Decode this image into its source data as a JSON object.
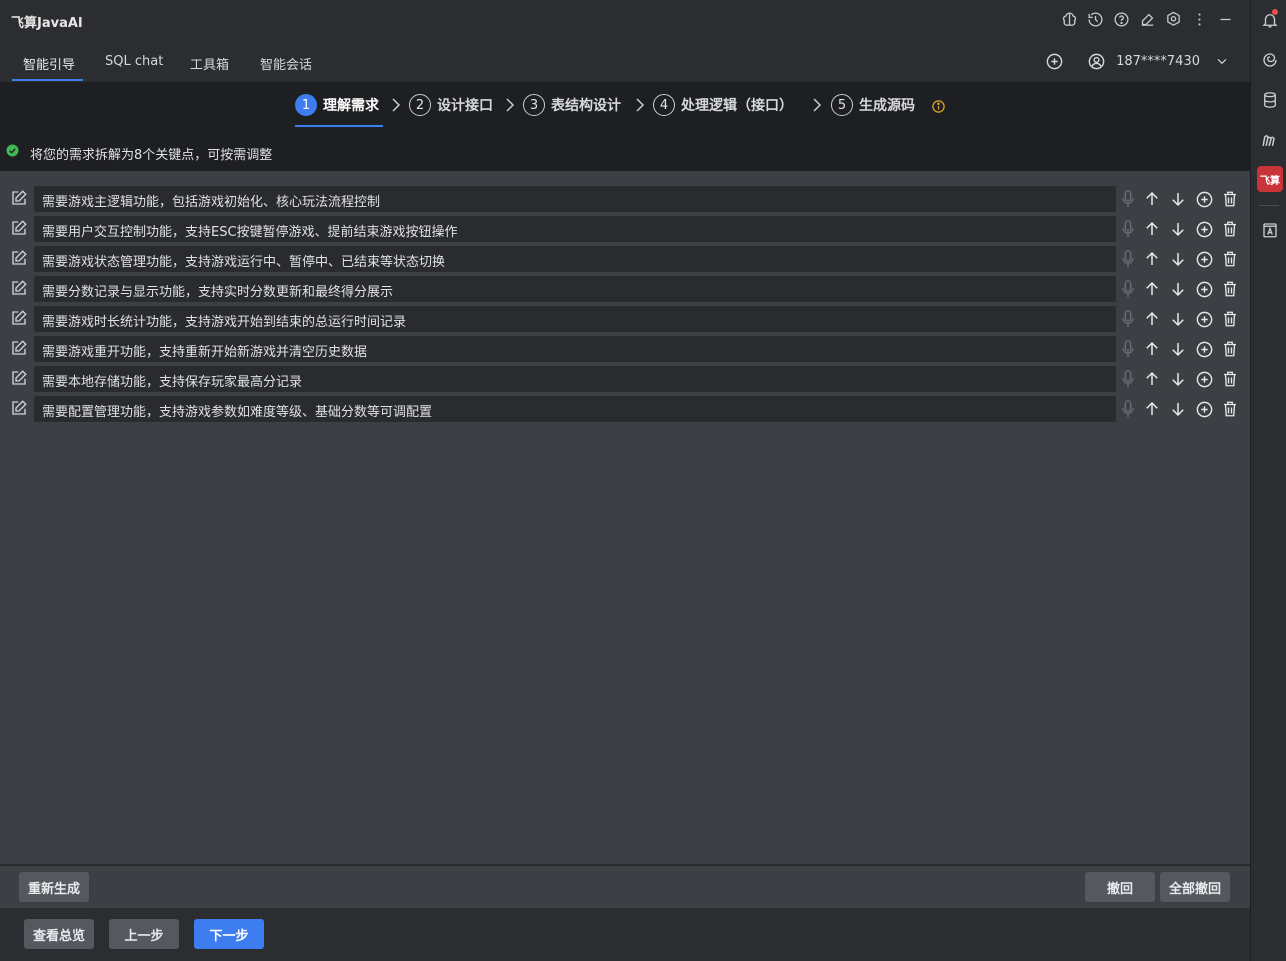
{
  "app": {
    "title": "飞算JavaAI"
  },
  "tabs": [
    {
      "label": "智能引导"
    },
    {
      "label": "SQL chat"
    },
    {
      "label": "工具箱"
    },
    {
      "label": "智能会话"
    }
  ],
  "user": {
    "name": "187****7430"
  },
  "steps": [
    {
      "num": "1",
      "label": "理解需求"
    },
    {
      "num": "2",
      "label": "设计接口"
    },
    {
      "num": "3",
      "label": "表结构设计"
    },
    {
      "num": "4",
      "label": "处理逻辑（接口）"
    },
    {
      "num": "5",
      "label": "生成源码"
    }
  ],
  "status": {
    "text": "将您的需求拆解为8个关键点，可按需调整"
  },
  "requirements": [
    "需要游戏主逻辑功能，包括游戏初始化、核心玩法流程控制",
    "需要用户交互控制功能，支持ESC按键暂停游戏、提前结束游戏按钮操作",
    "需要游戏状态管理功能，支持游戏运行中、暂停中、已结束等状态切换",
    "需要分数记录与显示功能，支持实时分数更新和最终得分展示",
    "需要游戏时长统计功能，支持游戏开始到结束的总运行时间记录",
    "需要游戏重开功能，支持重新开始新游戏并清空历史数据",
    "需要本地存储功能，支持保存玩家最高分记录",
    "需要配置管理功能，支持游戏参数如难度等级、基础分数等可调配置"
  ],
  "actions": {
    "regenerate": "重新生成",
    "undo": "撤回",
    "undo_all": "全部撤回",
    "overview": "查看总览",
    "prev": "上一步",
    "next": "下一步"
  },
  "strip": {
    "feisuan_label": "飞算"
  },
  "colors": {
    "accent": "#3d7df0",
    "success": "#3fb950",
    "warning": "#e0a526",
    "notify": "#e5534b"
  }
}
